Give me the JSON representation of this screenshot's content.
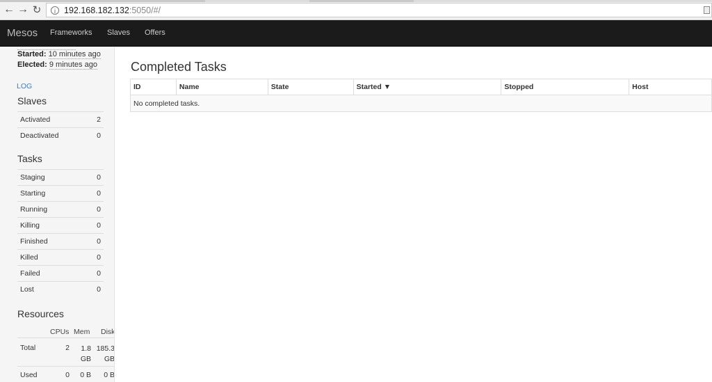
{
  "browser": {
    "url_host": "192.168.182.132",
    "url_rest": ":5050/#/",
    "back_icon": "arrow-left-icon",
    "forward_icon": "arrow-right-icon",
    "reload_icon": "reload-icon",
    "info_glyph": "i"
  },
  "navbar": {
    "brand": "Mesos",
    "links": [
      "Frameworks",
      "Slaves",
      "Offers"
    ]
  },
  "sidebar": {
    "started_label": "Started:",
    "started_value": "10 minutes ago",
    "elected_label": "Elected:",
    "elected_value": "9 minutes ago",
    "log_link": "LOG",
    "slaves_title": "Slaves",
    "slaves": [
      {
        "label": "Activated",
        "value": "2"
      },
      {
        "label": "Deactivated",
        "value": "0"
      }
    ],
    "tasks_title": "Tasks",
    "tasks": [
      {
        "label": "Staging",
        "value": "0"
      },
      {
        "label": "Starting",
        "value": "0"
      },
      {
        "label": "Running",
        "value": "0"
      },
      {
        "label": "Killing",
        "value": "0"
      },
      {
        "label": "Finished",
        "value": "0"
      },
      {
        "label": "Killed",
        "value": "0"
      },
      {
        "label": "Failed",
        "value": "0"
      },
      {
        "label": "Lost",
        "value": "0"
      }
    ],
    "resources_title": "Resources",
    "resources_headers": [
      "CPUs",
      "Mem",
      "Disk"
    ],
    "resources_rows": [
      {
        "label": "Total",
        "cpus": "2",
        "mem": "1.8 GB",
        "disk": "185.3 GB"
      },
      {
        "label": "Used",
        "cpus": "0",
        "mem": "0 B",
        "disk": "0 B"
      }
    ]
  },
  "main": {
    "title": "Completed Tasks",
    "columns": [
      "ID",
      "Name",
      "State",
      "Started ▼",
      "Stopped",
      "Host"
    ],
    "empty_message": "No completed tasks."
  }
}
